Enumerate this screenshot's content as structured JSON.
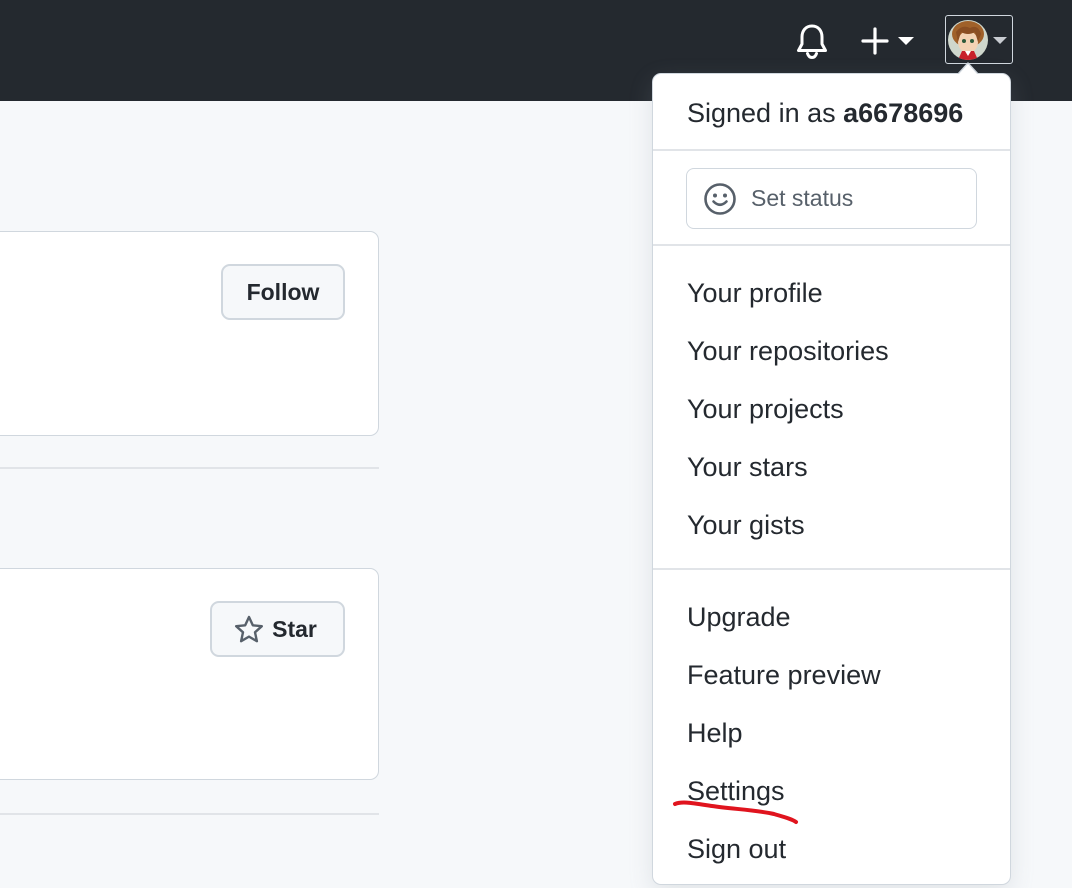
{
  "header": {
    "notifications_icon": "bell-icon",
    "create_icon": "plus-icon",
    "avatar_alt": "user-avatar"
  },
  "cards": {
    "follow_label": "Follow",
    "star_label": "Star"
  },
  "menu": {
    "signed_in_prefix": "Signed in as",
    "username": "a6678696",
    "set_status": "Set status",
    "items": [
      "Your profile",
      "Your repositories",
      "Your projects",
      "Your stars",
      "Your gists",
      "Upgrade",
      "Feature preview",
      "Help",
      "Settings",
      "Sign out"
    ]
  },
  "colors": {
    "header_bg": "#24292f",
    "page_bg": "#f6f8fa",
    "annotation_red": "#e0141e"
  }
}
